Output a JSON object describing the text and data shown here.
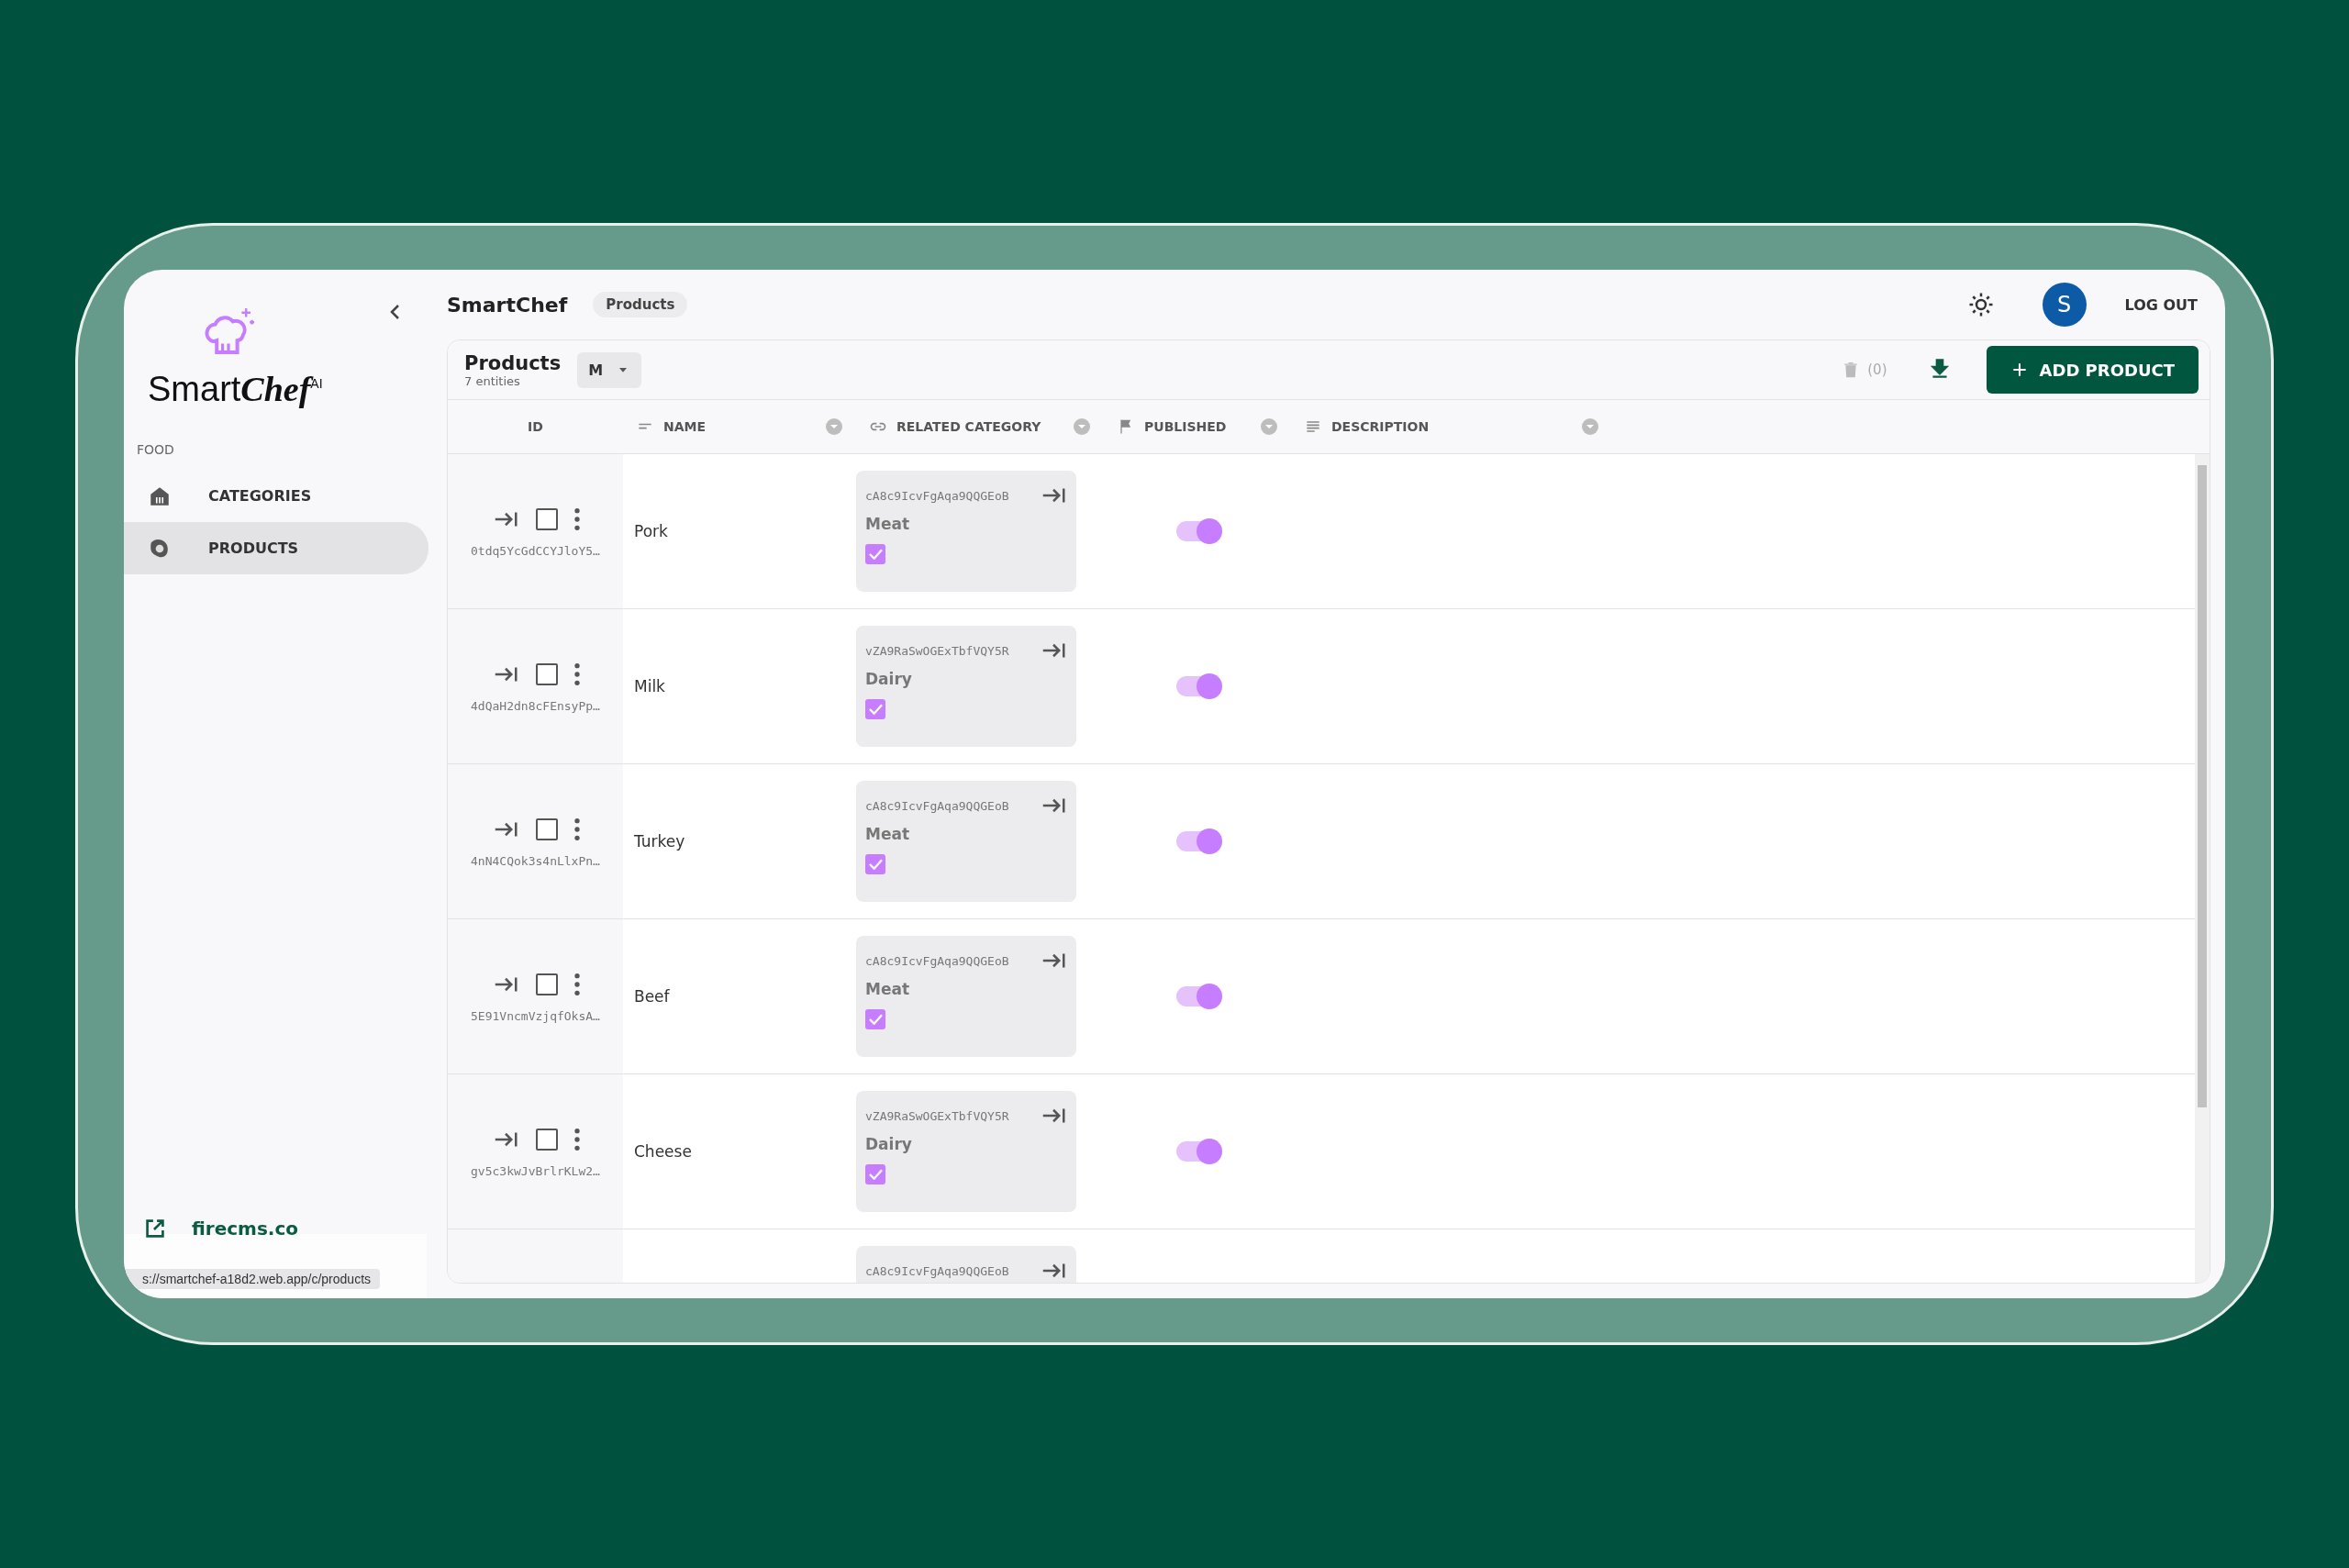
{
  "sidebar": {
    "logo": {
      "text": "Smart",
      "accent": "Chef",
      "badge": "AI"
    },
    "group": "FOOD",
    "items": [
      {
        "label": "CATEGORIES",
        "kind": "categories",
        "selected": false
      },
      {
        "label": "PRODUCTS",
        "kind": "products",
        "selected": true
      }
    ],
    "footer_link": "firecms.co"
  },
  "header": {
    "title": "SmartChef",
    "breadcrumb": "Products",
    "avatar": "S",
    "logout": "LOG OUT"
  },
  "collection": {
    "title": "Products",
    "count": "7 entities",
    "size": "M",
    "delete_count": "(0)",
    "add_button": "ADD PRODUCT"
  },
  "table": {
    "columns": [
      {
        "label": "ID",
        "kind": "id"
      },
      {
        "label": "NAME",
        "kind": "text"
      },
      {
        "label": "RELATED CATEGORY",
        "kind": "reference"
      },
      {
        "label": "PUBLISHED",
        "kind": "boolean"
      },
      {
        "label": "DESCRIPTION",
        "kind": "multiline"
      }
    ],
    "rows": [
      {
        "id": "0tdq5YcGdCCYJloY5…",
        "selected": false,
        "name": "Pork",
        "category": {
          "id": "cA8c9IcvFgAqa9QQGEoB",
          "name": "Meat",
          "checked": true
        },
        "published": true
      },
      {
        "id": "4dQaH2dn8cFEnsyPp…",
        "selected": false,
        "name": "Milk",
        "category": {
          "id": "vZA9RaSwOGExTbfVQY5R",
          "name": "Dairy",
          "checked": true
        },
        "published": true
      },
      {
        "id": "4nN4CQok3s4nLlxPn…",
        "selected": false,
        "name": "Turkey",
        "category": {
          "id": "cA8c9IcvFgAqa9QQGEoB",
          "name": "Meat",
          "checked": true
        },
        "published": true
      },
      {
        "id": "5E91VncmVzjqfOksA…",
        "selected": false,
        "name": "Beef",
        "category": {
          "id": "cA8c9IcvFgAqa9QQGEoB",
          "name": "Meat",
          "checked": true
        },
        "published": true
      },
      {
        "id": "gv5c3kwJvBrlrKLw2…",
        "selected": false,
        "name": "Cheese",
        "category": {
          "id": "vZA9RaSwOGExTbfVQY5R",
          "name": "Dairy",
          "checked": true
        },
        "published": true
      },
      {
        "category": {
          "id": "cA8c9IcvFgAqa9QQGEoB"
        }
      }
    ]
  },
  "status_url": "s://smartchef-a18d2.web.app/c/products"
}
